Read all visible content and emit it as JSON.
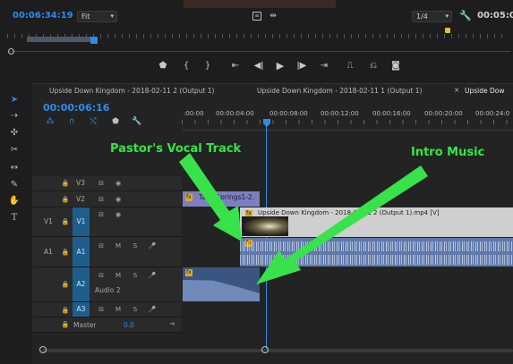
{
  "program_monitor": {
    "playhead_timecode": "00:06:34:19",
    "fit_label": "Fit",
    "resolution": "1/4",
    "duration_timecode": "00:05:0",
    "controls": [
      "add-marker",
      "mark-in",
      "mark-out",
      "go-to-in",
      "step-back",
      "play",
      "step-forward",
      "go-to-out",
      "lift",
      "extract",
      "export-frame"
    ]
  },
  "timeline": {
    "tabs": [
      {
        "label": "Upside Down Kingdom - 2018-02-11 2 (Output 1)",
        "active": false
      },
      {
        "label": "Upside Down Kingdom - 2018-02-11 1 (Output 1)",
        "active": false
      },
      {
        "label": "Upside Dow",
        "active": true
      }
    ],
    "tab_close": "×",
    "timecode": "00:00:06:16",
    "ruler_labels": [
      ":00:00",
      "00:00:04:00",
      "00:00:08:00",
      "00:00:12:00",
      "00:00:16:00",
      "00:00:20:00",
      "00:00:24:0"
    ],
    "video_tracks": [
      {
        "target": "",
        "name": "V3"
      },
      {
        "target": "",
        "name": "V2"
      },
      {
        "target": "V1",
        "name": "V1"
      }
    ],
    "audio_tracks": [
      {
        "target": "A1",
        "name": "A1",
        "label": ""
      },
      {
        "target": "",
        "name": "A2",
        "label": "Audio 2"
      },
      {
        "target": "",
        "name": "A3",
        "label": ""
      }
    ],
    "master": {
      "label": "Master",
      "value": "0.0"
    },
    "track_buttons": {
      "mute": "M",
      "solo": "S"
    },
    "clips": {
      "v2": "Tate_Springs1-2.",
      "v1": "Upside Down Kingdom - 2018-02-11 2 (Output 1).mp4 [V]",
      "fx_badge": "fx"
    }
  },
  "annotations": {
    "pastor": "Pastor's Vocal Track",
    "intro": "Intro Music"
  },
  "colors": {
    "timecode_blue": "#2d8ceb",
    "track_target_blue": "#1e5e8c",
    "video_clip": "#7d7fc2",
    "audio_clip": "#5f79a8",
    "annotation_green": "#38e24a"
  }
}
